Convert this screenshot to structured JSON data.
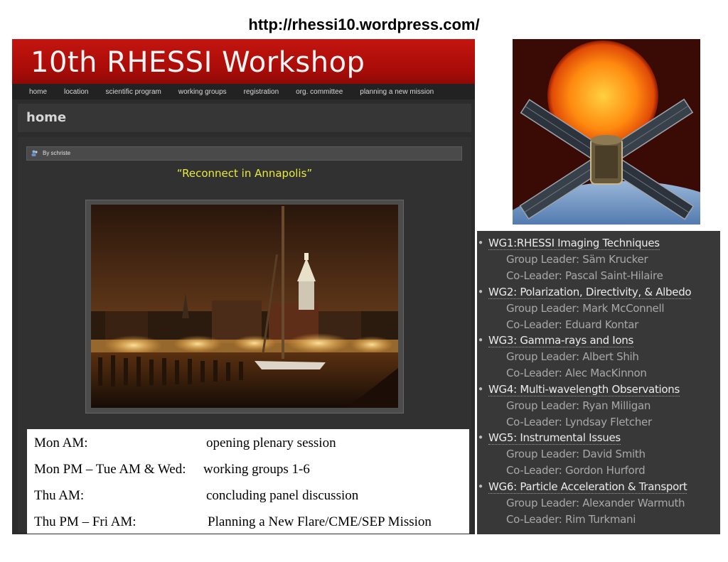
{
  "url": "http://rhessi10.wordpress.com/",
  "site": {
    "title": "10th RHESSI Workshop",
    "nav": [
      "home",
      "location",
      "scientific program",
      "working groups",
      "registration",
      "org. committee",
      "planning a new mission"
    ],
    "section_title": "home",
    "byline": "By schriste",
    "quote": "“Reconnect in Annapolis”"
  },
  "schedule": [
    {
      "when": "Mon AM:",
      "what": "opening plenary session"
    },
    {
      "when": "Mon PM – Tue AM & Wed:",
      "what": "working groups 1-6"
    },
    {
      "when": "Thu AM:",
      "what": "concluding panel discussion"
    },
    {
      "when": "Thu PM – Fri AM:",
      "what": "Planning a New Flare/CME/SEP Mission"
    }
  ],
  "working_groups": [
    {
      "title": "WG1:RHESSI Imaging Techniques",
      "leader": "Group Leader: Säm Krucker",
      "coleader": "Co-Leader: Pascal Saint-Hilaire"
    },
    {
      "title": "WG2: Polarization, Directivity, & Albedo",
      "leader": "Group Leader: Mark McConnell",
      "coleader": "Co-Leader: Eduard Kontar"
    },
    {
      "title": "WG3: Gamma-rays and Ions",
      "leader": "Group Leader: Albert Shih",
      "coleader": "Co-Leader: Alec MacKinnon"
    },
    {
      "title": "WG4: Multi-wavelength Observations",
      "leader": "Group Leader: Ryan Milligan",
      "coleader": "Co-Leader: Lyndsay Fletcher"
    },
    {
      "title": "WG5: Instrumental Issues",
      "leader": "Group Leader: David Smith",
      "coleader": "Co-Leader: Gordon Hurford"
    },
    {
      "title": "WG6: Particle Acceleration & Transport",
      "leader": "Group Leader: Alexander Warmuth",
      "coleader": "Co-Leader: Rim Turkmani"
    }
  ],
  "colors": {
    "banner": "#b3120c",
    "quote": "#e9e93f",
    "page_bg": "#2c2c2c"
  }
}
